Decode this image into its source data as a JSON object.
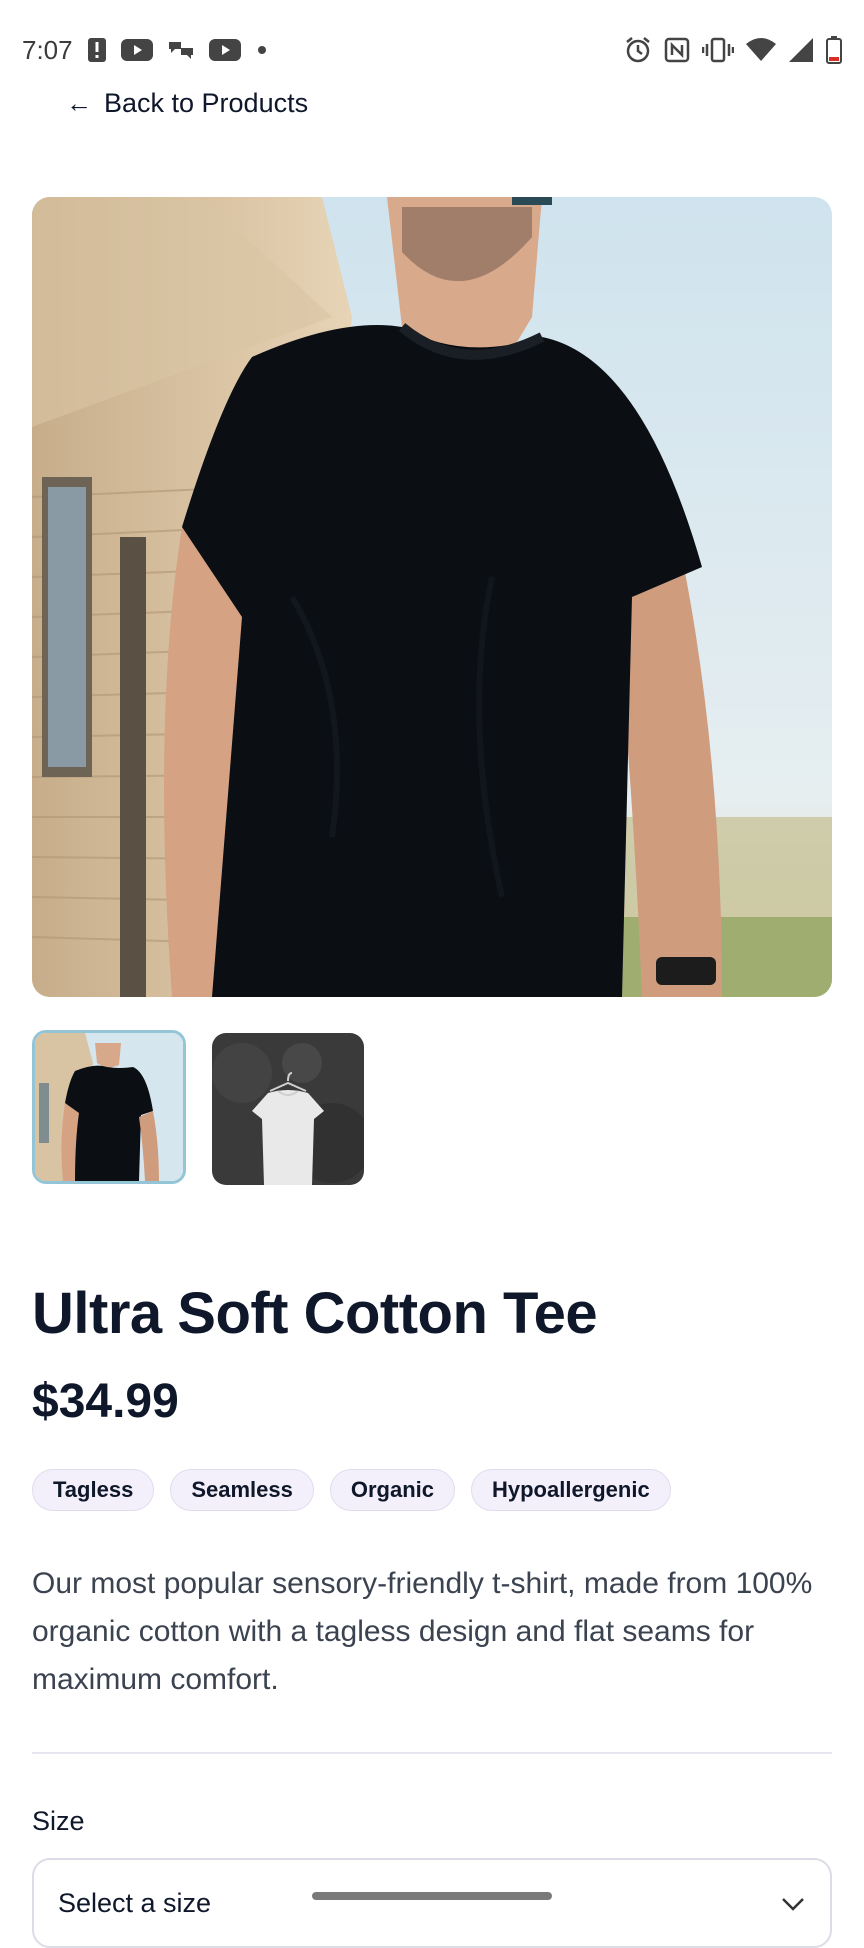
{
  "status": {
    "time": "7:07",
    "left_icons": [
      "alert-icon",
      "youtube-icon",
      "cast-icon",
      "youtube-icon",
      "dot-icon"
    ],
    "right_icons": [
      "alarm-icon",
      "nfc-icon",
      "vibrate-icon",
      "wifi-icon",
      "signal-icon",
      "battery-icon"
    ],
    "battery_color": "#d93025"
  },
  "nav": {
    "back_label": "Back to Products",
    "back_arrow": "←"
  },
  "product": {
    "title": "Ultra Soft Cotton Tee",
    "price": "$34.99",
    "tags": [
      "Tagless",
      "Seamless",
      "Organic",
      "Hypoallergenic"
    ],
    "description": "Our most popular sensory-friendly t-shirt, made from 100% organic cotton with a tagless design and flat seams for maximum comfort."
  },
  "gallery": {
    "main_image": "model-wearing-black-tee",
    "thumbnails": [
      {
        "image": "model-wearing-black-tee",
        "selected": true
      },
      {
        "image": "white-tee-on-hanger",
        "selected": false
      }
    ],
    "accent": "#93c5d6"
  },
  "size": {
    "label": "Size",
    "placeholder": "Select a size"
  }
}
